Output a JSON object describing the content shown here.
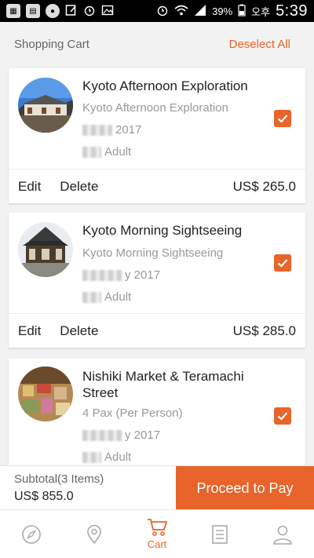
{
  "status_bar": {
    "battery": "39%",
    "carrier_text": "오후",
    "time": "5:39",
    "left_icons": [
      "app-icon",
      "app-icon",
      "app-icon",
      "edit-icon",
      "alarm-icon",
      "image-icon"
    ],
    "right_icons": [
      "alarm-icon",
      "wifi-icon",
      "signal-icon",
      "battery-icon"
    ]
  },
  "header": {
    "title": "Shopping Cart",
    "deselect_label": "Deselect All"
  },
  "cart_items": [
    {
      "title": "Kyoto Afternoon Exploration",
      "subtitle": "Kyoto Afternoon Exploration",
      "date": "2017",
      "pax": "Adult",
      "checked": true,
      "edit_label": "Edit",
      "delete_label": "Delete",
      "price": "US$ 265.0"
    },
    {
      "title": "Kyoto Morning Sightseeing",
      "subtitle": "Kyoto Morning Sightseeing",
      "date": "y 2017",
      "pax": "Adult",
      "checked": true,
      "edit_label": "Edit",
      "delete_label": "Delete",
      "price": "US$ 285.0"
    },
    {
      "title": "Nishiki Market & Teramachi Street",
      "subtitle": "4 Pax (Per Person)",
      "date": "y 2017",
      "pax": "Adult",
      "checked": true
    }
  ],
  "footer": {
    "subtotal_label": "Subtotal(3 Items)",
    "subtotal_value": "US$ 855.0",
    "pay_label": "Proceed to Pay"
  },
  "bottom_nav": {
    "items": [
      "compass-icon",
      "location-pin-icon",
      "cart-icon",
      "list-icon",
      "profile-icon"
    ],
    "active_label": "Cart"
  },
  "colors": {
    "accent": "#e8642a",
    "muted_text": "#999999",
    "icon_gray": "#aaaaaa"
  }
}
